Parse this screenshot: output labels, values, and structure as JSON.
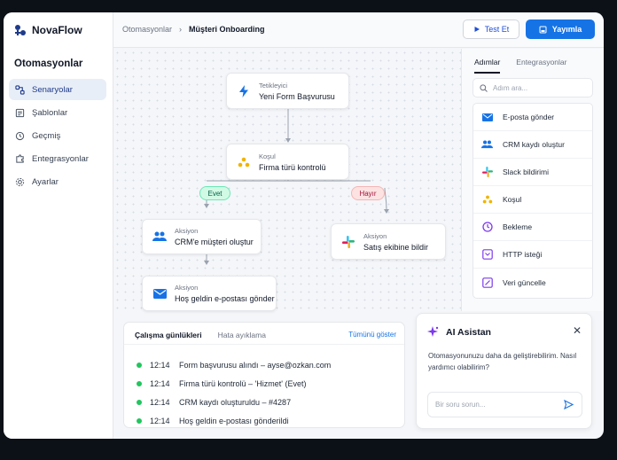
{
  "app": {
    "name": "NovaFlow"
  },
  "sidebar": {
    "title": "Otomasyonlar",
    "items": [
      {
        "label": "Senaryolar",
        "icon": "flow-icon",
        "active": true
      },
      {
        "label": "Şablonlar",
        "icon": "template-icon"
      },
      {
        "label": "Geçmiş",
        "icon": "history-icon"
      },
      {
        "label": "Entegrasyonlar",
        "icon": "puzzle-icon"
      },
      {
        "label": "Ayarlar",
        "icon": "gear-icon"
      }
    ]
  },
  "breadcrumb": {
    "parent": "Otomasyonlar",
    "separator": "›",
    "current": "Müşteri Onboarding"
  },
  "toolbar": {
    "test_label": "Test Et",
    "publish_label": "Yayımla"
  },
  "flow": {
    "trigger": {
      "kind": "Tetikleyici",
      "title": "Yeni Form Başvurusu",
      "icon": "lightning-icon"
    },
    "condition": {
      "kind": "Koşul",
      "title": "Firma türü kontrolü",
      "icon": "condition-icon"
    },
    "branch_yes": "Evet",
    "branch_no": "Hayır",
    "action_crm": {
      "kind": "Aksiyon",
      "title": "CRM'e müşteri oluştur",
      "icon": "users-icon"
    },
    "action_slack": {
      "kind": "Aksiyon",
      "title": "Satış ekibine bildir",
      "icon": "slack-icon"
    },
    "action_email": {
      "kind": "Aksiyon",
      "title": "Hoş geldin e-postası gönder",
      "icon": "mail-icon"
    }
  },
  "logs": {
    "tab_active": "Çalışma günlükleri",
    "tab_other": "Hata ayıklama",
    "show_all": "Tümünü göster",
    "rows": [
      {
        "time": "12:14",
        "text": "Form başvurusu alındı – ayse@ozkan.com"
      },
      {
        "time": "12:14",
        "text": "Firma türü kontrolü – 'Hizmet' (Evet)"
      },
      {
        "time": "12:14",
        "text": "CRM kaydı oluşturuldu – #4287"
      },
      {
        "time": "12:14",
        "text": "Hoş geldin e-postası gönderildi"
      }
    ]
  },
  "panel": {
    "tab_active": "Adımlar",
    "tab_other": "Entegrasyonlar",
    "search_placeholder": "Adım ara...",
    "steps": [
      {
        "label": "E-posta gönder",
        "icon": "mail-icon"
      },
      {
        "label": "CRM kaydı oluştur",
        "icon": "users-icon"
      },
      {
        "label": "Slack bildirimi",
        "icon": "slack-icon"
      },
      {
        "label": "Koşul",
        "icon": "condition-icon"
      },
      {
        "label": "Bekleme",
        "icon": "clock-icon"
      },
      {
        "label": "HTTP isteği",
        "icon": "http-icon"
      },
      {
        "label": "Veri güncelle",
        "icon": "edit-icon"
      }
    ]
  },
  "assistant": {
    "title": "AI Asistan",
    "message": "Otomasyonunuzu daha da geliştirebilirim. Nasıl yardımcı olabilirim?",
    "input_placeholder": "Bir soru sorun..."
  },
  "colors": {
    "primary": "#1673e6",
    "success": "#22c55e",
    "yes_pill": "#d1fae5",
    "no_pill": "#fde2e2"
  }
}
